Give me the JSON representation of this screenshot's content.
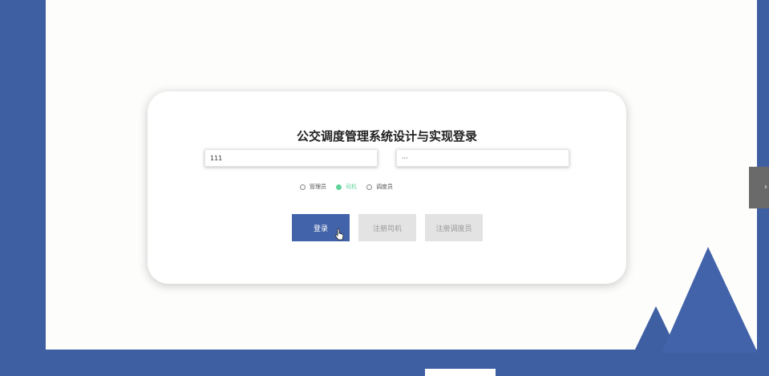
{
  "page": {
    "title": "公交调度管理系统设计与实现登录"
  },
  "login_form": {
    "username_value": "111",
    "password_value": "···",
    "roles": [
      {
        "label": "管理员",
        "checked": false
      },
      {
        "label": "司机",
        "checked": true
      },
      {
        "label": "调度员",
        "checked": false
      }
    ],
    "login_button": "登录",
    "register_driver_button": "注册司机",
    "register_dispatcher_button": "注册调度员"
  },
  "side_tab": {
    "glyph": "›"
  },
  "colors": {
    "primary": "#4263a9",
    "background_blue": "#3f5fa3",
    "selected_radio": "#5fd39a",
    "disabled_button": "#e3e3e3"
  },
  "icons": [
    "hand-pointer-icon",
    "chevron-right-icon",
    "mountain-decoration"
  ]
}
